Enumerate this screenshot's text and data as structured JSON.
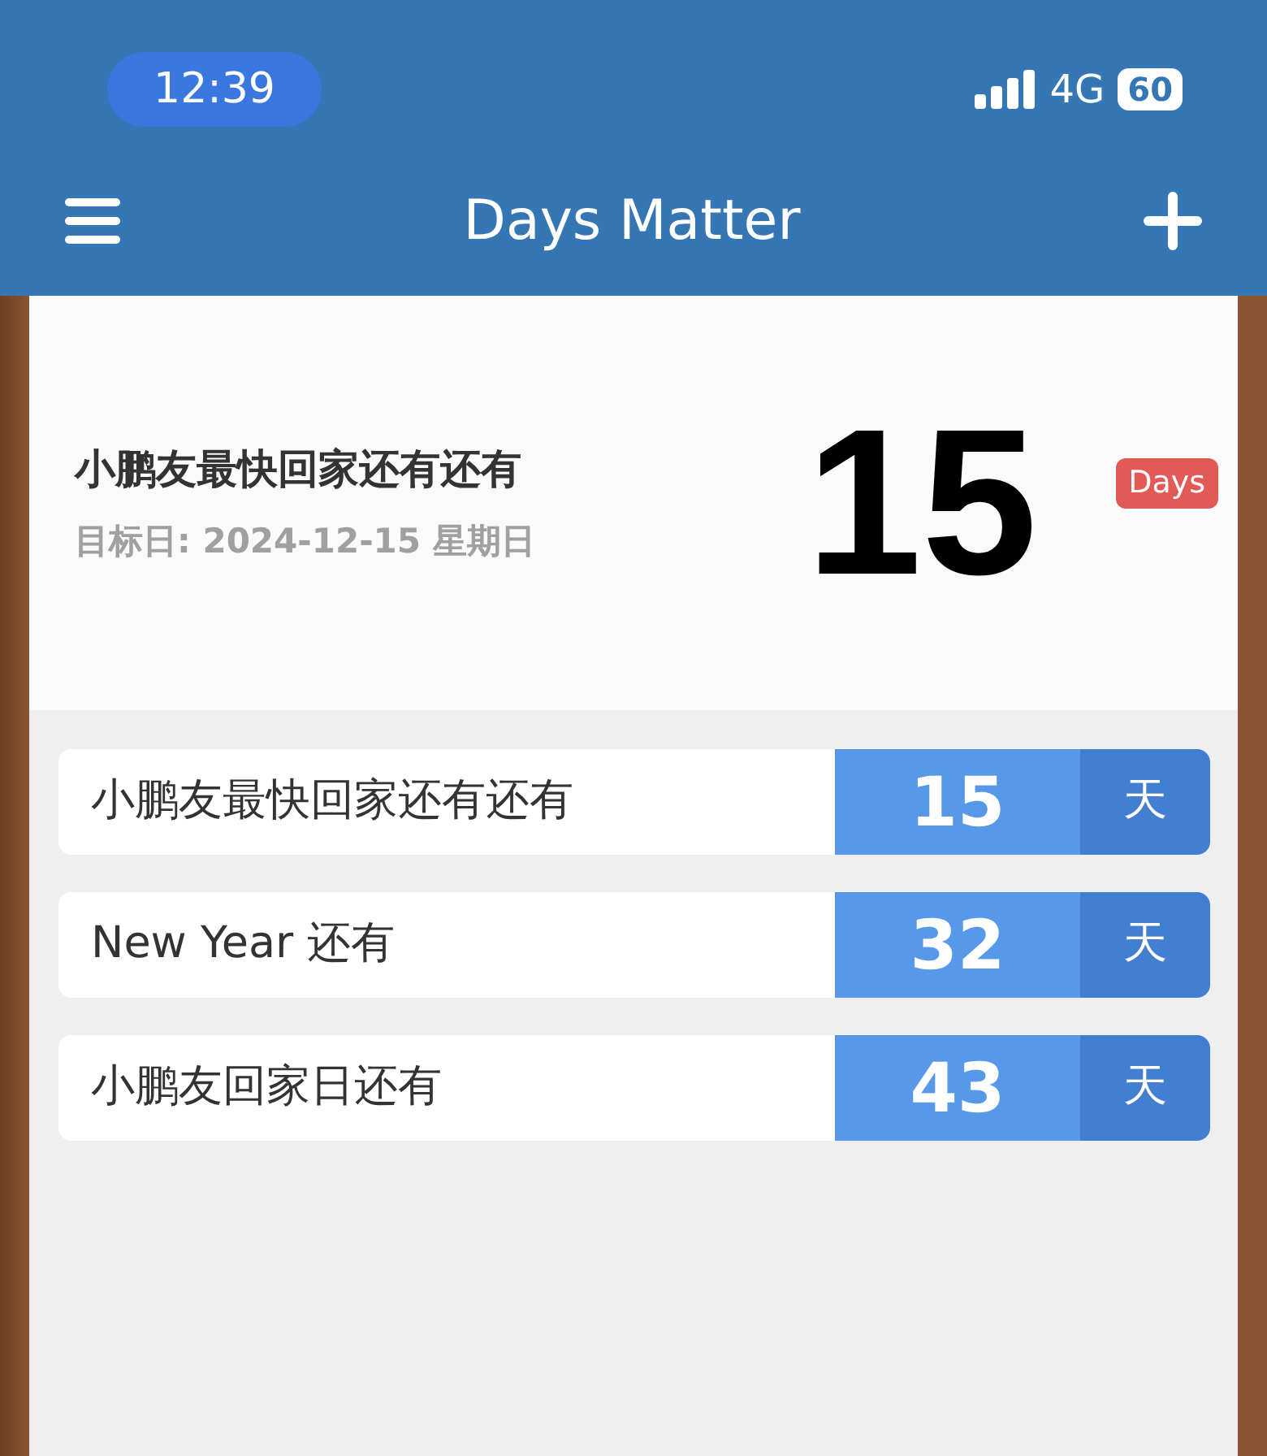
{
  "status_bar": {
    "time": "12:39",
    "network": "4G",
    "battery": "60"
  },
  "nav_bar": {
    "title": "Days Matter"
  },
  "featured": {
    "title": "小鹏友最快回家还有还有",
    "target_date": "目标日: 2024-12-15 星期日",
    "count": "15",
    "unit": "Days"
  },
  "events": [
    {
      "title": "小鹏友最快回家还有还有",
      "count": "15",
      "unit": "天"
    },
    {
      "title": "New Year 还有",
      "count": "32",
      "unit": "天"
    },
    {
      "title": "小鹏友回家日还有",
      "count": "43",
      "unit": "天"
    }
  ]
}
